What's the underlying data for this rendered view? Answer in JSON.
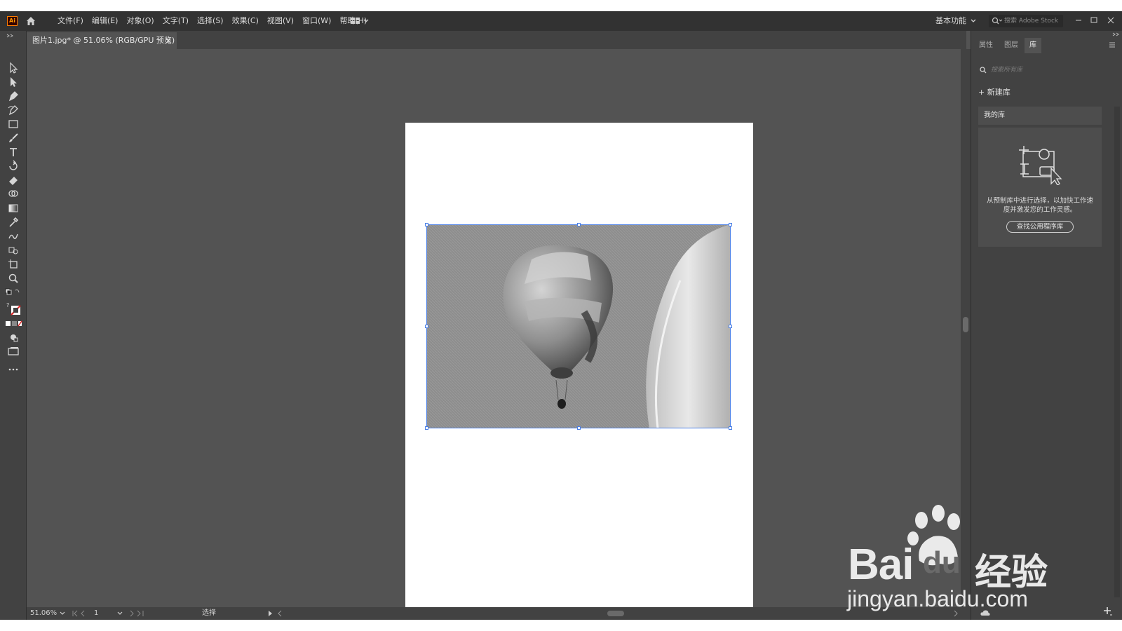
{
  "app": {
    "logo_text": "Ai",
    "menus": [
      "文件(F)",
      "编辑(E)",
      "对象(O)",
      "文字(T)",
      "选择(S)",
      "效果(C)",
      "视图(V)",
      "窗口(W)",
      "帮助(H)"
    ],
    "workspace_label": "基本功能",
    "stock_search_placeholder": "搜索 Adobe Stock"
  },
  "document_tab": {
    "title": "图片1.jpg* @ 51.06% (RGB/GPU 预览)",
    "close_glyph": "×"
  },
  "statusbar": {
    "zoom": "51.06%",
    "page": "1",
    "tool_status": "选择"
  },
  "panel": {
    "tabs": [
      "属性",
      "图层",
      "库"
    ],
    "active_tab": "库",
    "search_placeholder": "搜索所有库",
    "new_library": "+ 新建库",
    "my_library": "我的库",
    "description": "从预制库中进行选择，以加快工作速度并激发您的工作灵感。",
    "find_button": "查找公用程序库"
  },
  "watermark": {
    "brand_latin": "Bai",
    "brand_du": "du",
    "brand_cn": "经验",
    "url": "jingyan.baidu.com"
  },
  "colors": {
    "menubar": "#323232",
    "panel": "#424242",
    "canvas": "#535353",
    "selection": "#4a7fe6",
    "logo_accent": "#ff7c00"
  }
}
